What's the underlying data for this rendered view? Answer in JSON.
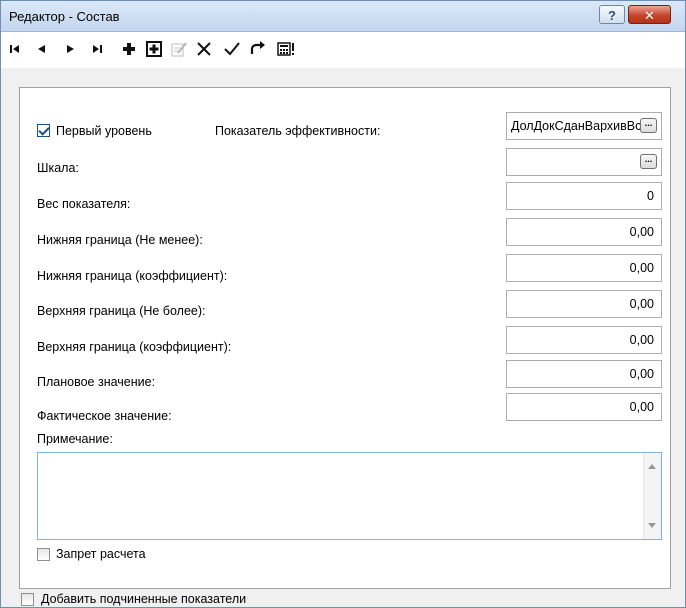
{
  "window": {
    "title": "Редактор - Состав",
    "help_label": "?",
    "close_label": "✕"
  },
  "toolbar": {
    "items": [
      {
        "name": "first-record-icon"
      },
      {
        "name": "prev-record-icon"
      },
      {
        "name": "next-record-icon"
      },
      {
        "name": "last-record-icon"
      },
      {
        "name": "add-icon"
      },
      {
        "name": "add-boxed-icon"
      },
      {
        "name": "edit-icon"
      },
      {
        "name": "delete-icon"
      },
      {
        "name": "apply-icon"
      },
      {
        "name": "refresh-icon"
      },
      {
        "name": "calculator-icon"
      }
    ]
  },
  "form": {
    "first_level": {
      "label": "Первый уровень",
      "checked": true
    },
    "indicator_label": "Показатель эффективности:",
    "indicator_value": "ДолДокСданВархивВсро",
    "scale_label": "Шкала:",
    "scale_value": "",
    "weight_label": "Вес показателя:",
    "weight_value": "0",
    "lower_bound_label": "Нижняя граница (Не менее):",
    "lower_bound_value": "0,00",
    "lower_coef_label": "Нижняя граница (коэффициент):",
    "lower_coef_value": "0,00",
    "upper_bound_label": "Верхняя граница (Не более):",
    "upper_bound_value": "0,00",
    "upper_coef_label": "Верхняя граница (коэффициент):",
    "upper_coef_value": "0,00",
    "planned_label": "Плановое значение:",
    "planned_value": "0,00",
    "actual_label": "Фактическое значение:",
    "actual_value": "0,00",
    "note_label": "Примечание:",
    "note_value": "",
    "calc_ban": {
      "label": "Запрет расчета",
      "checked": false
    },
    "ellipsis_label": "..."
  },
  "footer": {
    "add_subordinate": {
      "label": "Добавить подчиненные показатели",
      "checked": false
    }
  }
}
